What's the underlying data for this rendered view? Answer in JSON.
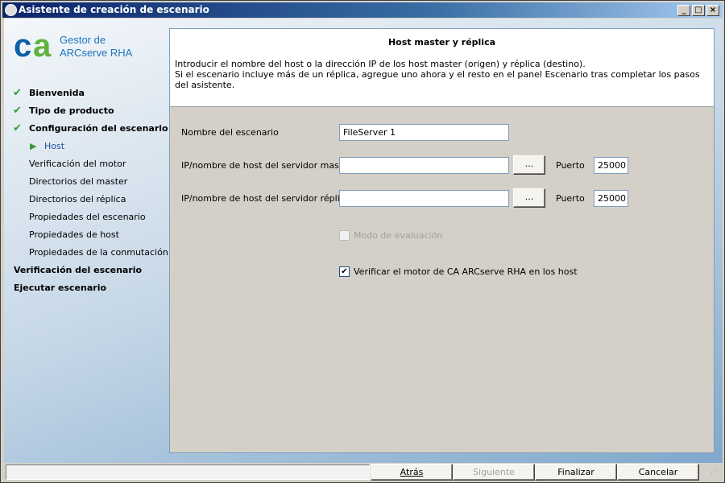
{
  "window": {
    "title": "Asistente de creación de escenario",
    "controls": [
      "_",
      "□",
      "×"
    ]
  },
  "logo": {
    "brand": "ca",
    "line1": "Gestor de",
    "line2": "ARCserve RHA"
  },
  "nav": [
    {
      "label": "Bienvenida",
      "state": "done"
    },
    {
      "label": "Tipo de producto",
      "state": "done"
    },
    {
      "label": "Configuración del escenario",
      "state": "done"
    },
    {
      "label": "Host",
      "state": "current"
    },
    {
      "label": "Verificación del motor",
      "state": "sub"
    },
    {
      "label": "Directorios del master",
      "state": "sub"
    },
    {
      "label": "Directorios del réplica",
      "state": "sub"
    },
    {
      "label": "Propiedades del escenario",
      "state": "sub"
    },
    {
      "label": "Propiedades de host",
      "state": "sub"
    },
    {
      "label": "Propiedades de la conmutación",
      "state": "sub"
    },
    {
      "label": "Verificación del escenario",
      "state": "top"
    },
    {
      "label": "Ejecutar escenario",
      "state": "top"
    }
  ],
  "header": {
    "title": "Host master y réplica",
    "line1": "Introducir el nombre del host o la dirección IP de los host master (origen) y réplica (destino).",
    "line2": "Si el escenario incluye más de un réplica, agregue uno ahora y el resto en el panel Escenario tras completar los pasos del asistente."
  },
  "form": {
    "scenario_label": "Nombre del escenario",
    "scenario_value": "FileServer 1",
    "master_label": "IP/nombre de host del servidor master",
    "master_value": "",
    "replica_label": "IP/nombre de host del servidor réplica",
    "replica_value": "",
    "browse": "...",
    "port_label": "Puerto",
    "master_port": "25000",
    "replica_port": "25000",
    "eval_label": "Modo de evaluación",
    "eval_checked": false,
    "verify_label": "Verificar el motor de CA ARCserve RHA en los host",
    "verify_checked": true
  },
  "footer": {
    "back": "Atrás",
    "next": "Siguiente",
    "finish": "Finalizar",
    "cancel": "Cancelar"
  }
}
